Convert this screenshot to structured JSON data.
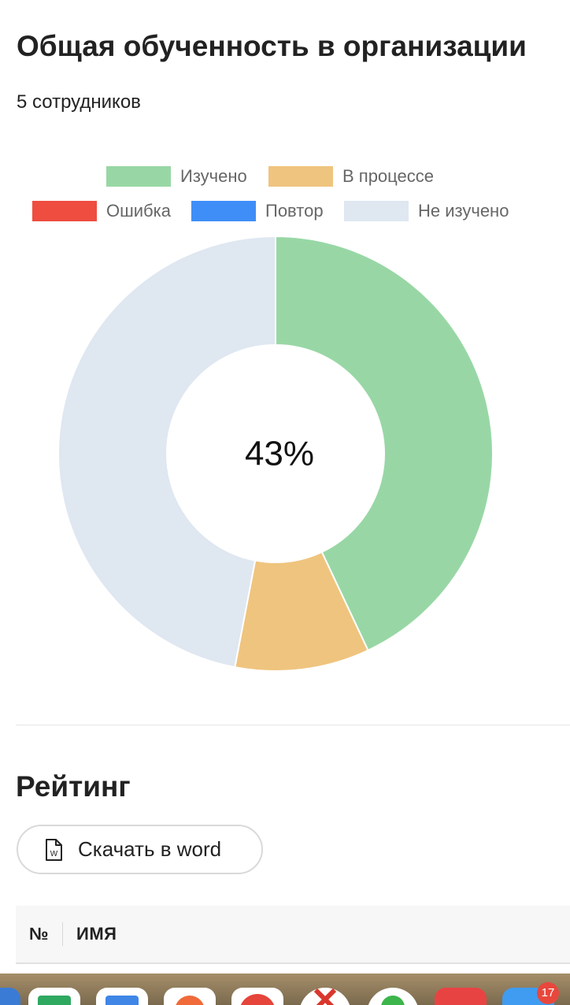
{
  "header": {
    "title": "Общая обученность в организации",
    "subtitle": "5 сотрудников"
  },
  "chart_data": {
    "type": "pie",
    "center_label": "43%",
    "legend_position": "top",
    "series": [
      {
        "name": "Изучено",
        "value": 43,
        "color": "#98d7a5"
      },
      {
        "name": "В процессе",
        "value": 10,
        "color": "#efc47e"
      },
      {
        "name": "Ошибка",
        "value": 0,
        "color": "#ee4d40"
      },
      {
        "name": "Повтор",
        "value": 0,
        "color": "#3f8ef7"
      },
      {
        "name": "Не изучено",
        "value": 47,
        "color": "#dfe7f1"
      }
    ]
  },
  "rating": {
    "title": "Рейтинг",
    "download_label": "Скачать в word",
    "download_icon": "word-document-icon"
  },
  "table": {
    "columns": [
      "№",
      "ИМЯ"
    ]
  },
  "dock": {
    "badge_count": "17",
    "icons": [
      "app-icon",
      "spreadsheet-icon",
      "mail-icon",
      "presentation-icon",
      "chrome-icon",
      "close-app-icon",
      "messenger-icon",
      "app-icon",
      "app-icon"
    ]
  }
}
